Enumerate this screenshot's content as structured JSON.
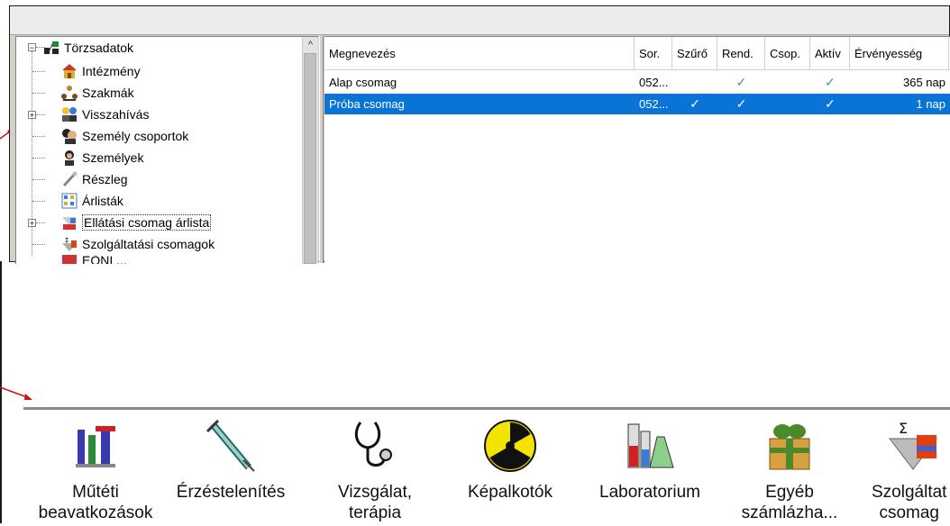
{
  "tree": {
    "items": [
      {
        "label": "Törzsadatok",
        "icon": "hierarchy-icon"
      },
      {
        "label": "Intézmény",
        "icon": "house-icon"
      },
      {
        "label": "Szakmák",
        "icon": "people-network-icon"
      },
      {
        "label": "Visszahívás",
        "icon": "people-pair-icon"
      },
      {
        "label": "Személy csoportok",
        "icon": "people-group-icon"
      },
      {
        "label": "Személyek",
        "icon": "person-icon"
      },
      {
        "label": "Részleg",
        "icon": "tools-icon"
      },
      {
        "label": "Árlisták",
        "icon": "price-list-icon"
      },
      {
        "label": "Ellátási csomag árlista",
        "icon": "package-pricelist-icon"
      },
      {
        "label": "Szolgáltatási csomagok",
        "icon": "service-package-icon"
      },
      {
        "label": "EŐNI ...",
        "icon": "partial-icon"
      }
    ]
  },
  "grid": {
    "columns": [
      "Megnevezés",
      "Sor.",
      "Szűrő",
      "Rend.",
      "Csop.",
      "Aktív",
      "Érvényesség"
    ],
    "rows": [
      {
        "name": "Alap csomag",
        "sor": "052...",
        "szuro": "",
        "rend": "✓",
        "csop": "",
        "aktiv": "✓",
        "ervenyesseg": "365 nap"
      },
      {
        "name": "Próba csomag",
        "sor": "052...",
        "szuro": "✓",
        "rend": "✓",
        "csop": "",
        "aktiv": "✓",
        "ervenyesseg": "1 nap"
      }
    ],
    "selected_row": 1,
    "selection_color": "#0a74d6"
  },
  "toolbar": {
    "buttons": [
      {
        "line1": "Műtéti",
        "line2": "beavatkozások",
        "icon": "surgery-tools-icon"
      },
      {
        "line1": "Érzéstelenítés",
        "line2": "",
        "icon": "syringe-icon"
      },
      {
        "line1": "Vizsgálat,",
        "line2": "terápia",
        "icon": "stethoscope-icon"
      },
      {
        "line1": "Képalkotók",
        "line2": "",
        "icon": "radiation-icon"
      },
      {
        "line1": "Laboratorium",
        "line2": "",
        "icon": "lab-flask-icon"
      },
      {
        "line1": "Egyéb",
        "line2": "számlázha...",
        "icon": "gift-box-icon"
      },
      {
        "line1": "Szolgáltat",
        "line2": "csomag",
        "icon": "sigma-package-icon"
      }
    ]
  }
}
